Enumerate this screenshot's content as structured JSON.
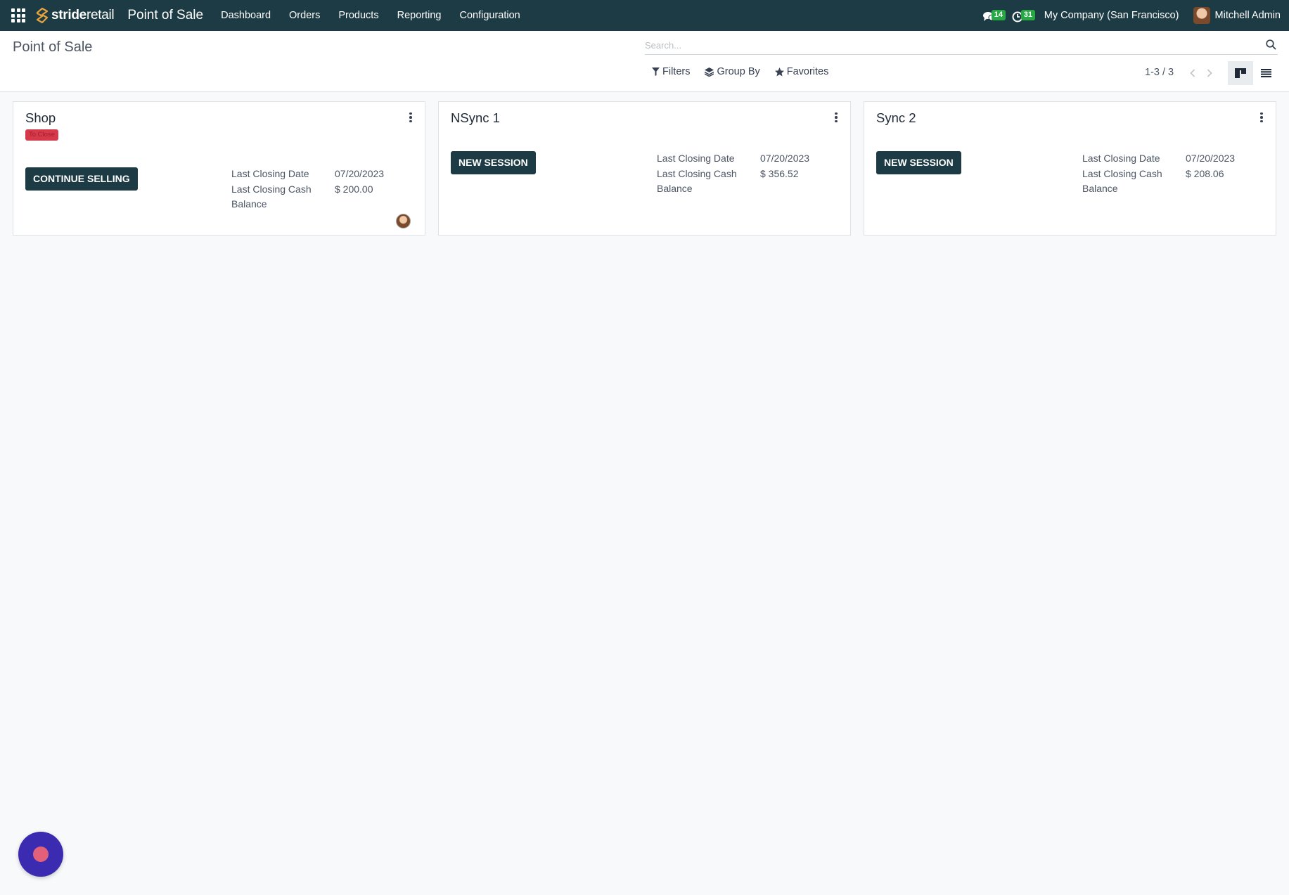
{
  "navbar": {
    "brand": {
      "part1": "stride",
      "part2": "retail"
    },
    "app_title": "Point of Sale",
    "menu": [
      "Dashboard",
      "Orders",
      "Products",
      "Reporting",
      "Configuration"
    ],
    "messages_count": "14",
    "activities_count": "31",
    "company": "My Company (San Francisco)",
    "user": "Mitchell Admin"
  },
  "control_panel": {
    "breadcrumb": "Point of Sale",
    "search_placeholder": "Search...",
    "filters_label": "Filters",
    "group_by_label": "Group By",
    "favorites_label": "Favorites",
    "pager": "1-3 / 3"
  },
  "cards": [
    {
      "title": "Shop",
      "badge": "To Close",
      "button": "CONTINUE SELLING",
      "last_closing_date_label": "Last Closing Date",
      "last_closing_date": "07/20/2023",
      "last_closing_cash_label_1": "Last Closing Cash",
      "last_closing_cash_label_2": "Balance",
      "last_closing_cash": "$ 200.00"
    },
    {
      "title": "NSync 1",
      "button": "NEW SESSION",
      "last_closing_date_label": "Last Closing Date",
      "last_closing_date": "07/20/2023",
      "last_closing_cash_label_1": "Last Closing Cash",
      "last_closing_cash_label_2": "Balance",
      "last_closing_cash": "$ 356.52"
    },
    {
      "title": "Sync 2",
      "button": "NEW SESSION",
      "last_closing_date_label": "Last Closing Date",
      "last_closing_date": "07/20/2023",
      "last_closing_cash_label_1": "Last Closing Cash",
      "last_closing_cash_label_2": "Balance",
      "last_closing_cash": "$ 208.06"
    }
  ],
  "colors": {
    "navbar": "#1d3b44",
    "primary_button": "#1d3b44",
    "badge_danger": "#d63a4a",
    "counter_green": "#28a745",
    "fab": "#3b2bb0"
  }
}
